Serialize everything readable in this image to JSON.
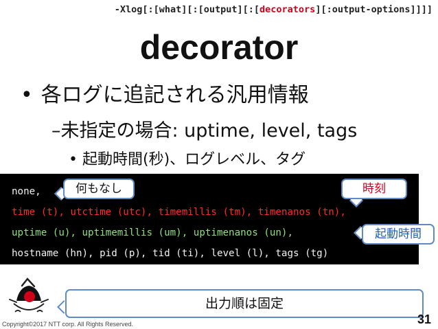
{
  "header": {
    "cmd_prefix": "-Xlog[:[what][:[output][:[",
    "cmd_highlight": "decorators",
    "cmd_suffix": "][:output-options]]]]"
  },
  "title": "decorator",
  "bullets": {
    "level1": "各ログに追記される汎用情報",
    "level2": "–未指定の場合: uptime, level, tags",
    "level3": "起動時間(秒)、ログレベル、タグ"
  },
  "code": {
    "line1": "none,",
    "line2": "time (t), utctime (utc), timemillis (tm), timenanos (tn),",
    "line3": "uptime (u), uptimemillis (um), uptimenanos (un),",
    "line4": "hostname (hn), pid (p), tid (ti), level (l), tags (tg)"
  },
  "callouts": {
    "nothing": "何もなし",
    "time": "時刻",
    "uptime": "起動時間",
    "order": "出力順は固定"
  },
  "colors": {
    "highlight": "#d0021b",
    "code_bg": "#000000",
    "code_red": "#ff2a2a",
    "code_green": "#8ee07a",
    "callout_border": "#5f8ac4"
  },
  "icons": {
    "bullet": "•",
    "logo": "duke-mascot-icon"
  },
  "footer": {
    "copyright": "Copyright©2017  NTT corp. All Rights Reserved.",
    "page_number": "31"
  }
}
